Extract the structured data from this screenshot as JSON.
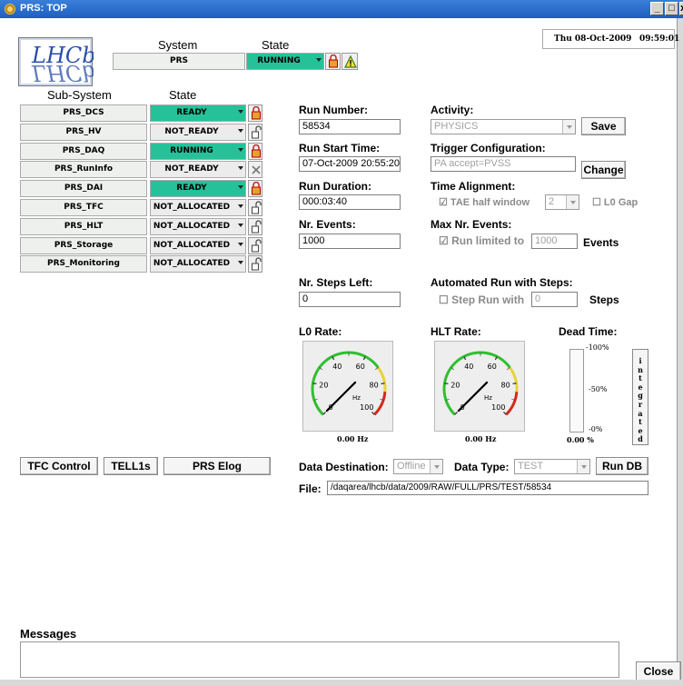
{
  "window": {
    "title": "PRS: TOP",
    "controls": [
      "_",
      "□",
      "x"
    ]
  },
  "logo": {
    "text_top": "LHCb",
    "text_bottom": "ΓHCb"
  },
  "datetime": {
    "date": "Thu 08-Oct-2009",
    "time": "09:59:01"
  },
  "system": {
    "system_header": "System",
    "state_header": "State",
    "name": "PRS",
    "state": "RUNNING"
  },
  "subsystems": {
    "header_name": "Sub-System",
    "header_state": "State",
    "rows": [
      {
        "name": "PRS_DCS",
        "state": "READY",
        "lock": "locked",
        "active": true
      },
      {
        "name": "PRS_HV",
        "state": "NOT_READY",
        "lock": "unlocked",
        "active": false
      },
      {
        "name": "PRS_DAQ",
        "state": "RUNNING",
        "lock": "locked",
        "active": true
      },
      {
        "name": "PRS_RunInfo",
        "state": "NOT_READY",
        "lock": "excluded",
        "active": false
      },
      {
        "name": "PRS_DAI",
        "state": "READY",
        "lock": "locked",
        "active": true
      },
      {
        "name": "PRS_TFC",
        "state": "NOT_ALLOCATED",
        "lock": "unlocked",
        "active": false
      },
      {
        "name": "PRS_HLT",
        "state": "NOT_ALLOCATED",
        "lock": "unlocked",
        "active": false
      },
      {
        "name": "PRS_Storage",
        "state": "NOT_ALLOCATED",
        "lock": "unlocked",
        "active": false
      },
      {
        "name": "PRS_Monitoring",
        "state": "NOT_ALLOCATED",
        "lock": "unlocked",
        "active": false
      }
    ]
  },
  "run": {
    "run_number_label": "Run Number:",
    "run_number": "58534",
    "start_time_label": "Run Start Time:",
    "start_time": "07-Oct-2009 20:55:20",
    "duration_label": "Run Duration:",
    "duration": "000:03:40",
    "events_label": "Nr. Events:",
    "events": "1000",
    "steps_left_label": "Nr. Steps Left:",
    "steps_left": "0"
  },
  "activity": {
    "label": "Activity:",
    "value": "PHYSICS",
    "save_label": "Save"
  },
  "trigger": {
    "label": "Trigger Configuration:",
    "value": "PA accept=PVSS",
    "change_label": "Change"
  },
  "time_alignment": {
    "label": "Time Alignment:",
    "tae_label": "TAE half window",
    "tae_value": "2",
    "l0gap_label": "L0 Gap"
  },
  "max_events": {
    "label": "Max Nr. Events:",
    "limit_label": "Run limited to",
    "limit_value": "1000",
    "unit": "Events"
  },
  "steps": {
    "label": "Automated Run with Steps:",
    "step_label": "Step Run with",
    "step_value": "0",
    "unit": "Steps"
  },
  "rates": {
    "l0_label": "L0 Rate:",
    "l0_value": "0.00 Hz",
    "hlt_label": "HLT Rate:",
    "hlt_value": "0.00 Hz",
    "dead_label": "Dead Time:",
    "dead_value": "0.00 %",
    "dead_100": "-100%",
    "dead_50": "-50%",
    "dead_0": "-0%",
    "gauge_ticks": [
      "0",
      "20",
      "40",
      "60",
      "80",
      "100"
    ],
    "gauge_unit": "Hz",
    "integrated_label": "Integrated"
  },
  "buttons": {
    "tfc_control": "TFC Control",
    "tell1s": "TELL1s",
    "prs_elog": "PRS Elog",
    "run_db": "Run DB",
    "close": "Close"
  },
  "data": {
    "destination_label": "Data Destination:",
    "destination_value": "Offline",
    "type_label": "Data Type:",
    "type_value": "TEST",
    "file_label": "File:",
    "file_value": "/daqarea/lhcb/data/2009/RAW/FULL/PRS/TEST/58534"
  },
  "messages": {
    "label": "Messages"
  },
  "colors": {
    "title_bar": "#1f5fbf",
    "running_green": "#25c29a",
    "lock_red": "#d03020"
  }
}
